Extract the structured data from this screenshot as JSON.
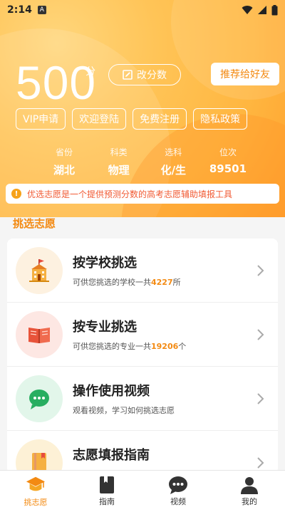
{
  "status_bar": {
    "time": "2:14",
    "badge": "A"
  },
  "hero": {
    "score": "500",
    "score_unit": "分",
    "edit_label": "改分数",
    "recommend_label": "推荐给好友",
    "pills": [
      "VIP申请",
      "欢迎登陆",
      "免费注册",
      "隐私政策"
    ],
    "stats": [
      {
        "label": "省份",
        "value": "湖北"
      },
      {
        "label": "科类",
        "value": "物理"
      },
      {
        "label": "选科",
        "value": "化/生"
      },
      {
        "label": "位次",
        "value": "89501"
      }
    ]
  },
  "notice": {
    "text": "优选志愿是一个提供预测分数的高考志愿辅助填报工具"
  },
  "section": {
    "title": "挑选志愿"
  },
  "items": [
    {
      "title": "按学校挑选",
      "desc_prefix": "可供您挑选的学校一共",
      "count": "4227",
      "desc_suffix": "所",
      "icon": "school-icon",
      "circle": "#fdf1e0"
    },
    {
      "title": "按专业挑选",
      "desc_prefix": "可供您挑选的专业一共",
      "count": "19206",
      "desc_suffix": "个",
      "icon": "book-icon",
      "circle": "#fde7e3"
    },
    {
      "title": "操作使用视频",
      "desc_prefix": "观看视频，学习如何挑选志愿",
      "count": "",
      "desc_suffix": "",
      "icon": "chat-video-icon",
      "circle": "#e2f6ea"
    },
    {
      "title": "志愿填报指南",
      "desc_prefix": "",
      "count": "",
      "desc_suffix": "",
      "icon": "guide-icon",
      "circle": "#fdf1d6"
    }
  ],
  "tabs": [
    {
      "label": "挑志愿",
      "icon": "graduation-cap-icon",
      "active": true
    },
    {
      "label": "指南",
      "icon": "guide-book-icon",
      "active": false
    },
    {
      "label": "视频",
      "icon": "chat-bubble-icon",
      "active": false
    },
    {
      "label": "我的",
      "icon": "person-icon",
      "active": false
    }
  ],
  "colors": {
    "accent": "#f38a12",
    "hero": "#ffb640",
    "notice_text": "#f15a33"
  }
}
